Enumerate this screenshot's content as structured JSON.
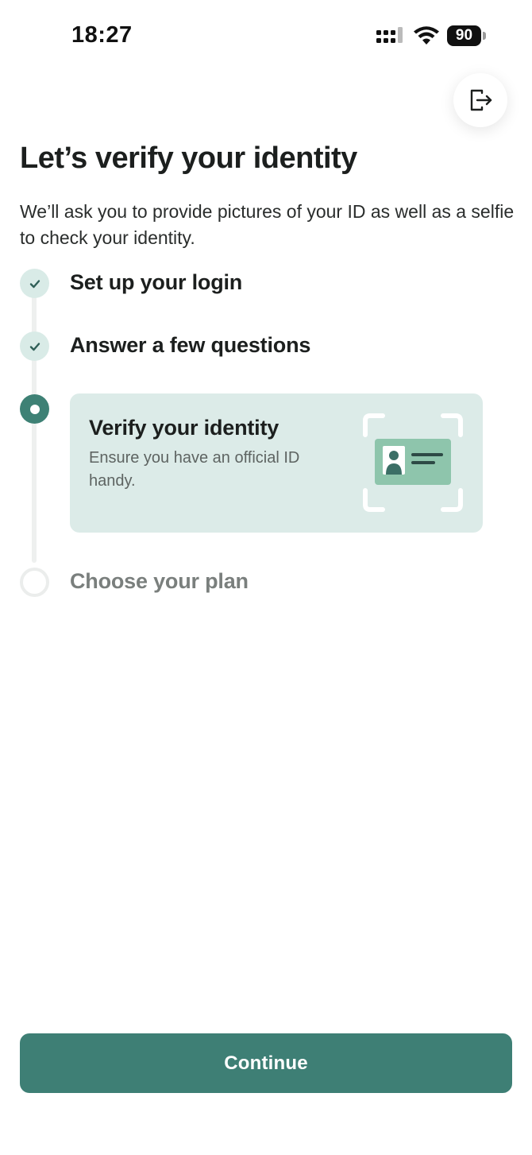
{
  "status_bar": {
    "time": "18:27",
    "battery": "90"
  },
  "header": {
    "title": "Let’s verify your identity",
    "subtitle": "We’ll ask you to provide pictures of your ID as well as a selfie to check your identity."
  },
  "steps": [
    {
      "label": "Set up your login",
      "state": "done"
    },
    {
      "label": "Answer a few questions",
      "state": "done"
    },
    {
      "label": "Verify your identity",
      "state": "active",
      "description": "Ensure you have an official ID handy."
    },
    {
      "label": "Choose your plan",
      "state": "todo"
    }
  ],
  "actions": {
    "continue_label": "Continue"
  },
  "icons": {
    "logout": "logout-icon",
    "check": "check-icon",
    "id_card": "id-card-illustration"
  },
  "colors": {
    "accent": "#3e7f75",
    "card_bg": "#dcebe8",
    "done_dot": "#d9ebe7"
  }
}
